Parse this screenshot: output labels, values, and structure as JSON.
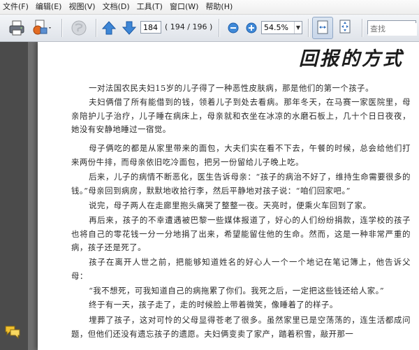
{
  "menu": [
    "文件(F)",
    "编辑(E)",
    "视图(V)",
    "文档(D)",
    "工具(T)",
    "窗口(W)",
    "帮助(H)"
  ],
  "toolbar": {
    "page_number": "184",
    "page_count": "( 194 / 196 )",
    "zoom": "54.5%",
    "search_placeholder": "查找"
  },
  "document": {
    "title": "回报的方式",
    "paragraphs": [
      "一对法国农民夫妇15岁的儿子得了一种恶性皮肤病，那是他们的第一个孩子。",
      "夫妇俩借了所有能借到的钱，领着儿子到处去看病。那年冬天，在马赛一家医院里，母亲陪护儿子治疗，儿子睡在病床上，母亲就和衣坐在冰凉的水磨石板上，几十个日日夜夜，她没有安静地睡过一宿觉。",
      "母子俩吃的都是从家里带来的面包，大夫们实在看不下去，午餐的时候，总会给他们打来两份牛排，而母亲依旧吃冷面包，把另一份留给儿子晚上吃。",
      "后来，儿子的病情不断恶化，医生告诉母亲：“孩子的病治不好了，维持生命需要很多的钱。”母亲回到病房，默默地收拾行李，然后平静地对孩子说：“咱们回家吧。”",
      "说完，母子两人在走廊里抱头痛哭了整整一夜。天亮时，便乘火车回到了家。",
      "再后来，孩子的不幸遭遇被巴黎一些媒体报道了，好心的人们纷纷捐款，连学校的孩子也将自己的零花钱一分一分地捐了出来，希望能留住他的生命。然而，这是一种非常严重的病，孩子还是死了。",
      "孩子在离开人世之前，把能够知道姓名的好心人一个一个地记在笔记簿上，他告诉父母：",
      "“我不想死，可我知道自己的病拖累了你们。我死之后，一定把这些钱还给人家。”",
      "终于有一天，孩子走了，走的时候脸上带着微笑，像睡着了的样子。",
      "埋葬了孩子，这对可怜的父母显得苍老了很多。虽然家里已是空荡荡的，连生活都成问题，但他们还没有遗忘孩子的遗愿。夫妇俩变卖了家产，踏着积雪，敲开那一"
    ]
  }
}
